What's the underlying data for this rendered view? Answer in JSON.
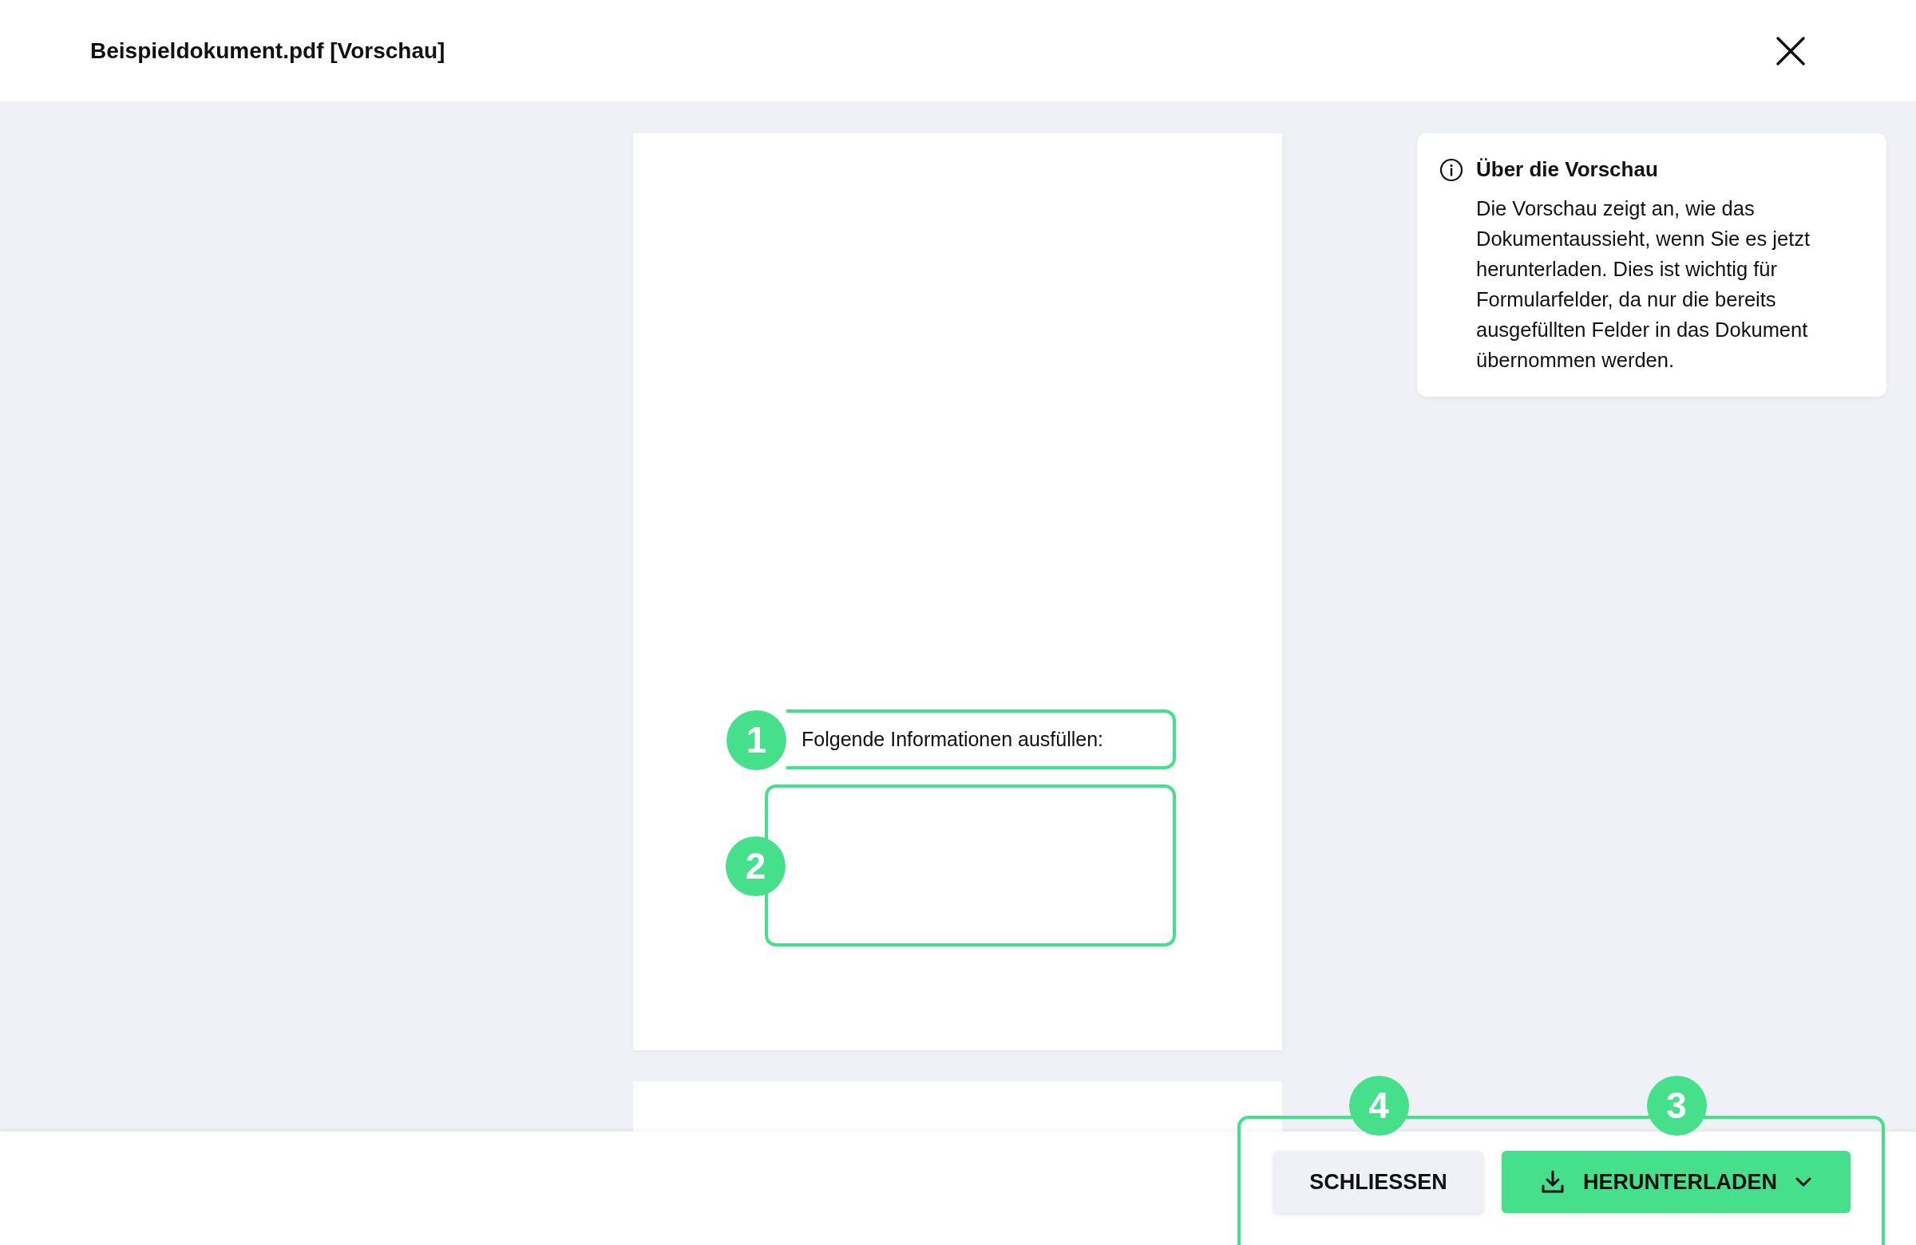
{
  "header": {
    "title": "Beispieldokument.pdf [Vorschau]"
  },
  "info": {
    "title": "Über die Vorschau",
    "body": "Die Vorschau zeigt an, wie das Dokumentaussieht, wenn Sie es jetzt herunterladen. Dies ist wichtig für Formularfelder, da nur die bereits ausgefüllten Felder in das Dokument übernommen werden."
  },
  "document": {
    "fields": [
      {
        "marker": "1",
        "kind": "label",
        "text": "Folgende Informationen ausfüllen:"
      },
      {
        "marker": "2",
        "kind": "area"
      }
    ]
  },
  "footer": {
    "buttons": [
      {
        "label": "SCHLIESSEN",
        "kind": "secondary",
        "marker": "4"
      },
      {
        "label": "HERUNTERLADEN",
        "kind": "primary",
        "marker": "3"
      }
    ]
  }
}
